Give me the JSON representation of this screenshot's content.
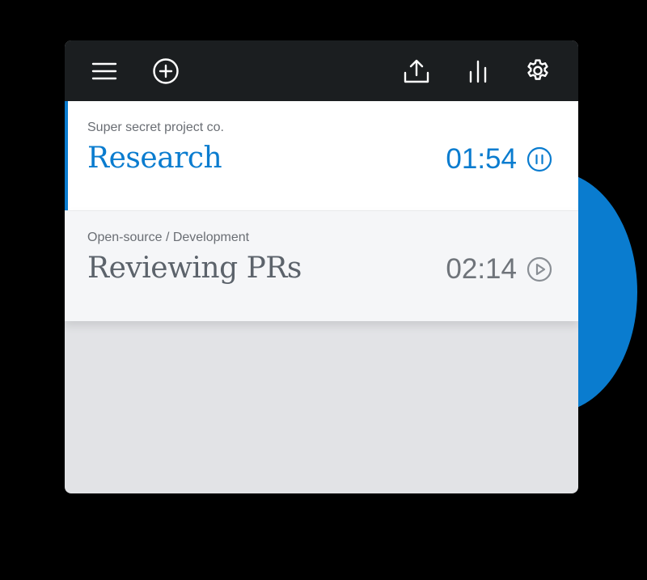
{
  "toolbar": {
    "left_icons": [
      "menu-icon",
      "add-circle-icon"
    ],
    "right_icons": [
      "upload-icon",
      "bar-chart-icon",
      "settings-gear-icon"
    ]
  },
  "entries": [
    {
      "project": "Super secret project co.",
      "task": "Research",
      "time": "01:54",
      "state": "running",
      "control_icon": "pause-circle-icon"
    },
    {
      "project": "Open-source / Development",
      "task": "Reviewing PRs",
      "time": "02:14",
      "state": "paused",
      "control_icon": "play-circle-icon"
    }
  ],
  "colors": {
    "accent": "#0a7ccf",
    "toolbar": "#1b1e20",
    "muted_text": "#6a6e74",
    "idle_task": "#5c636b",
    "empty_area": "#e2e3e6"
  }
}
